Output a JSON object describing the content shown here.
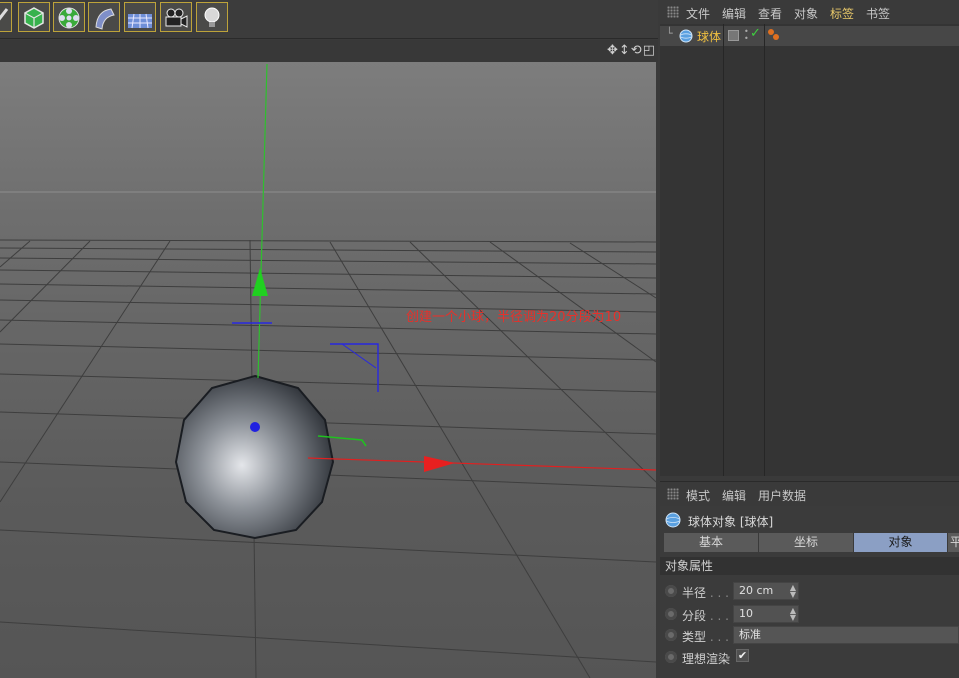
{
  "viewport": {
    "annotation": "创建一个小球，半径调为20分段为10"
  },
  "object_manager": {
    "menu": [
      "文件",
      "编辑",
      "查看",
      "对象",
      "标签",
      "书签"
    ],
    "active_menu_color": "#e8c86a",
    "object_name": "球体"
  },
  "attribute_manager": {
    "menu": [
      "模式",
      "编辑",
      "用户数据"
    ],
    "object_title": "球体对象 [球体]",
    "tabs": [
      "基本",
      "坐标",
      "对象",
      "平"
    ],
    "active_tab": "对象",
    "section": "对象属性",
    "properties": [
      {
        "label": "半径",
        "dots": " . . .",
        "value": "20 cm"
      },
      {
        "label": "分段",
        "dots": " . . .",
        "value": "10"
      },
      {
        "label": "类型",
        "dots": " . . .",
        "value": "标准"
      },
      {
        "label": "理想渲染",
        "dots": "",
        "value": "✔"
      }
    ]
  },
  "colors": {
    "accent_tab": "#8b9fc4",
    "annotation": "#e8302a",
    "axis_x": "#e02020",
    "axis_y": "#20c020",
    "axis_z": "#2020e0"
  }
}
